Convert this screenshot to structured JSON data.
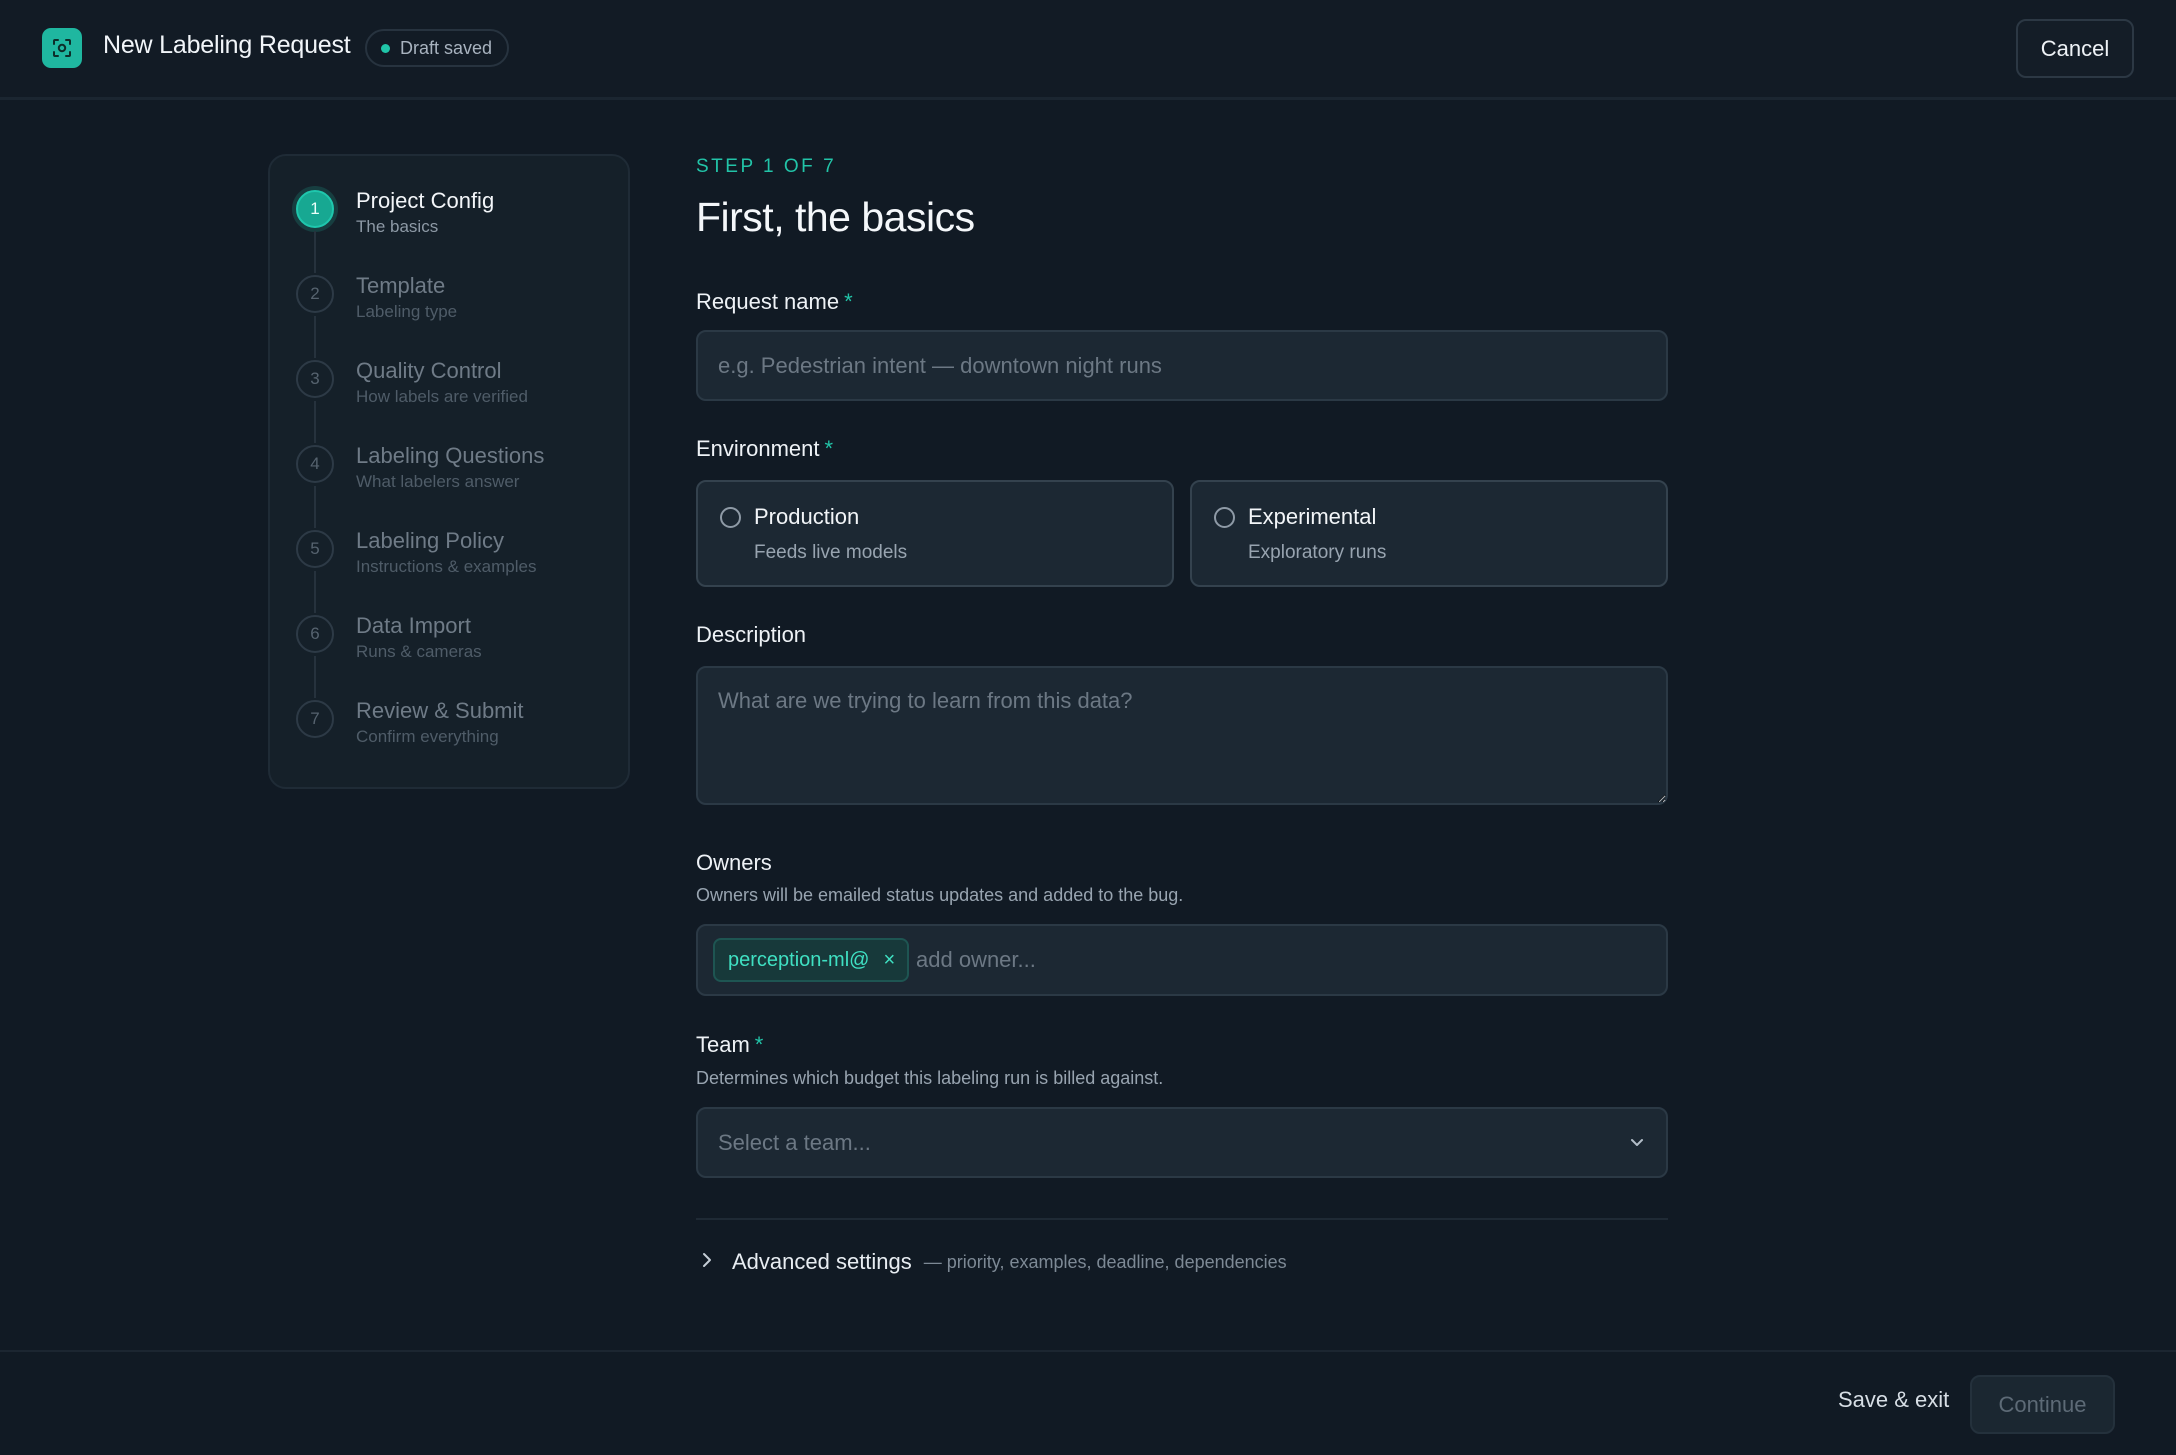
{
  "header": {
    "title": "New Labeling Request",
    "draft_status": "Draft saved",
    "cancel_label": "Cancel"
  },
  "stepper": {
    "steps": [
      {
        "number": "1",
        "title": "Project Config",
        "subtitle": "The basics",
        "active": true
      },
      {
        "number": "2",
        "title": "Template",
        "subtitle": "Labeling type",
        "active": false
      },
      {
        "number": "3",
        "title": "Quality Control",
        "subtitle": "How labels are verified",
        "active": false
      },
      {
        "number": "4",
        "title": "Labeling Questions",
        "subtitle": "What labelers answer",
        "active": false
      },
      {
        "number": "5",
        "title": "Labeling Policy",
        "subtitle": "Instructions & examples",
        "active": false
      },
      {
        "number": "6",
        "title": "Data Import",
        "subtitle": "Runs & cameras",
        "active": false
      },
      {
        "number": "7",
        "title": "Review & Submit",
        "subtitle": "Confirm everything",
        "active": false
      }
    ]
  },
  "form": {
    "eyebrow": "STEP 1 OF 7",
    "title": "First, the basics",
    "request_name": {
      "label": "Request name",
      "required_mark": "*",
      "value": "",
      "placeholder": "e.g. Pedestrian intent — downtown night runs"
    },
    "environment": {
      "label": "Environment",
      "required_mark": "*",
      "options": [
        {
          "title": "Production",
          "subtitle": "Feeds live models",
          "selected": false
        },
        {
          "title": "Experimental",
          "subtitle": "Exploratory runs",
          "selected": false
        }
      ]
    },
    "description": {
      "label": "Description",
      "value": "",
      "placeholder": "What are we trying to learn from this data?"
    },
    "owners": {
      "label": "Owners",
      "hint": "Owners will be emailed status updates and added to the bug.",
      "chips": [
        "perception-ml@"
      ],
      "remove_glyph": "×",
      "placeholder": "add owner..."
    },
    "team": {
      "label": "Team",
      "required_mark": "*",
      "hint": "Determines which budget this labeling run is billed against.",
      "placeholder": "Select a team..."
    },
    "advanced": {
      "title": "Advanced settings",
      "subtitle": "— priority, examples, deadline, dependencies"
    }
  },
  "footer": {
    "save_exit_label": "Save & exit",
    "continue_label": "Continue"
  },
  "colors": {
    "accent": "#22c4a8",
    "background": "#111a24",
    "surface": "#1c2833"
  },
  "icons": {
    "logo": "scan-icon",
    "select_chevron": "chevron-down-icon",
    "advanced_chevron": "chevron-right-icon",
    "chip_remove": "close-icon"
  }
}
